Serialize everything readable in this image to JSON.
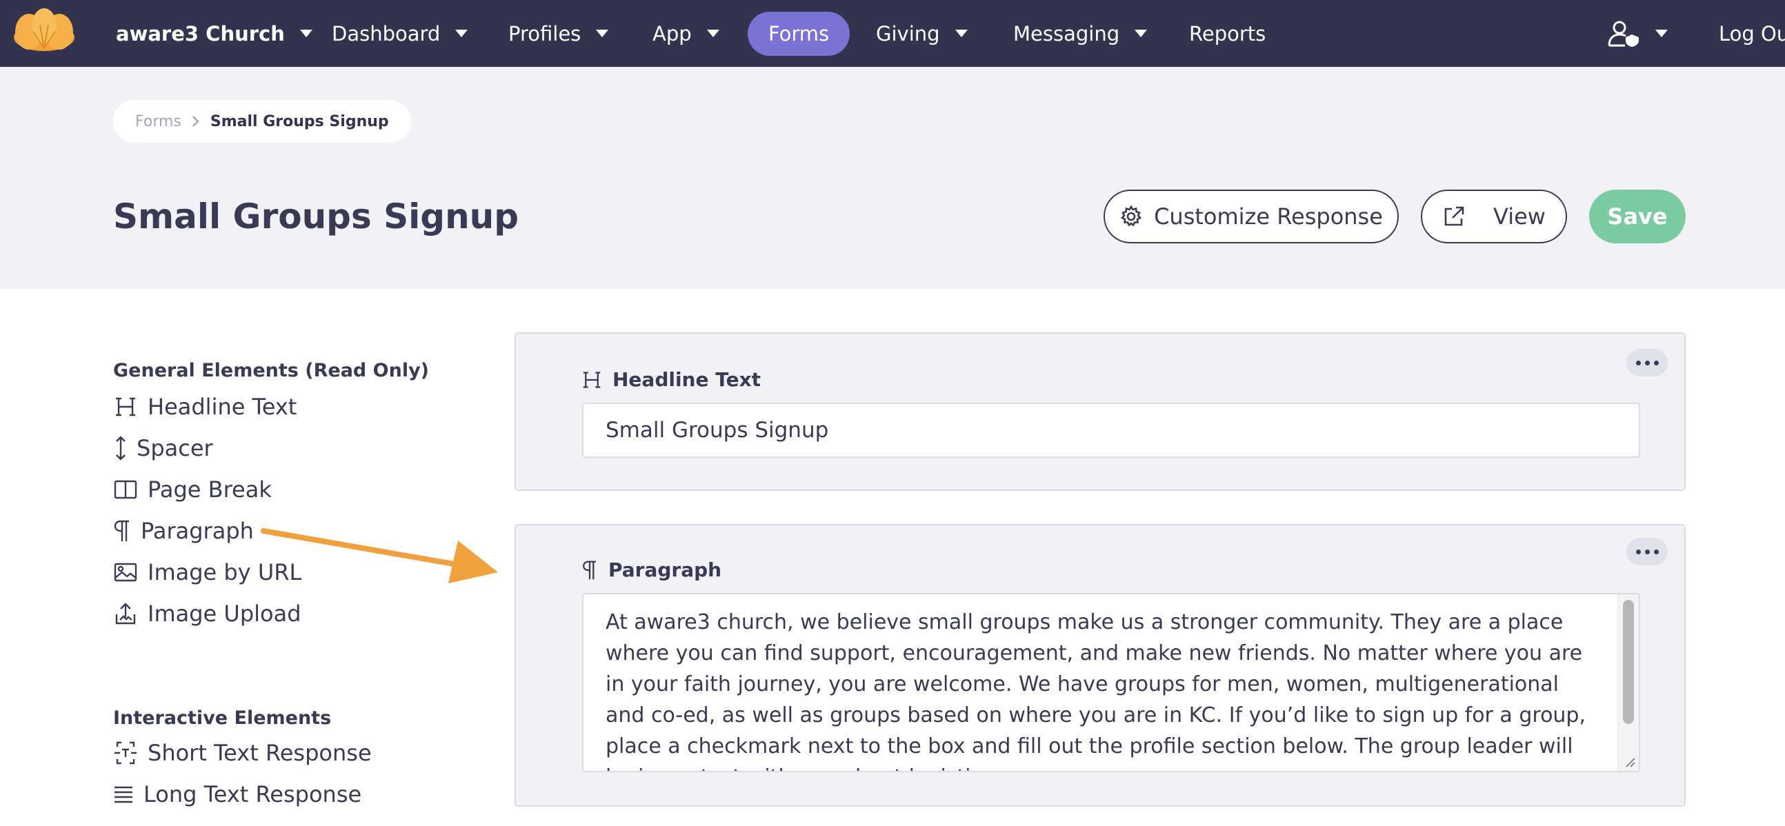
{
  "nav": {
    "org_label": "aware3 Church",
    "items": [
      {
        "label": "Dashboard"
      },
      {
        "label": "Profiles"
      },
      {
        "label": "App"
      },
      {
        "label": "Forms"
      },
      {
        "label": "Giving"
      },
      {
        "label": "Messaging"
      },
      {
        "label": "Reports"
      }
    ],
    "active": "Forms",
    "logout_label": "Log Ou",
    "colors": {
      "bar": "#33334f",
      "active_pill": "#7a73d6",
      "logo": "#f2a33a"
    }
  },
  "breadcrumb": {
    "items": [
      "Forms",
      "Small Groups Signup"
    ]
  },
  "page": {
    "title": "Small Groups Signup"
  },
  "actions": {
    "customize_label": "Customize Response",
    "view_label": "View",
    "save_label": "Save",
    "save_color": "#7bcba2"
  },
  "sidebar": {
    "general": {
      "heading": "General Elements (Read Only)",
      "items": [
        {
          "label": "Headline Text",
          "icon": "headline-icon"
        },
        {
          "label": "Spacer",
          "icon": "spacer-icon"
        },
        {
          "label": "Page Break",
          "icon": "page-break-icon"
        },
        {
          "label": "Paragraph",
          "icon": "paragraph-icon"
        },
        {
          "label": "Image by URL",
          "icon": "image-icon"
        },
        {
          "label": "Image Upload",
          "icon": "upload-icon"
        }
      ]
    },
    "interactive": {
      "heading": "Interactive Elements",
      "items": [
        {
          "label": "Short Text Response",
          "icon": "short-text-icon"
        },
        {
          "label": "Long Text Response",
          "icon": "long-text-icon"
        }
      ]
    }
  },
  "canvas": {
    "headline_card": {
      "label": "Headline Text",
      "value": "Small Groups Signup"
    },
    "paragraph_card": {
      "label": "Paragraph",
      "value": "At aware3 church, we believe small groups make us a stronger community. They are a place where you can find support, encouragement, and make new friends. No matter where you are in your faith journey, you are welcome. We have groups for men, women, multigenerational and co-ed, as well as groups based on where you are in KC. If you’d like to sign up for a group, place a checkmark next to the box and fill out the profile section below. The group leader will be in contact with you about logistics."
    }
  },
  "annotation": {
    "arrow_color": "#f0a03c"
  }
}
